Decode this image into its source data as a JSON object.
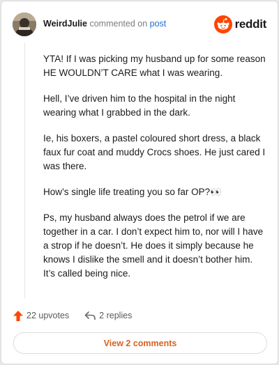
{
  "comment": {
    "username": "WeirdJulie",
    "action_text": "commented on",
    "post_link": "post",
    "paragraphs": [
      "YTA! If I was picking my husband up for some reason HE WOULDN’T CARE what I was wearing.",
      "Hell, I’ve driven him to the hospital in the night wearing what I grabbed in the dark.",
      "Ie, his boxers, a pastel coloured short dress, a black faux fur coat and muddy Crocs shoes. He just cared I was there.",
      "How’s single life treating you so far OP?👀",
      "Ps, my husband always does the petrol if we are together in a car. I don’t expect him to, nor will I have a strop if he doesn’t. He does it simply because he knows I dislike the smell and it doesn’t bother him. It’s called being nice."
    ]
  },
  "brand": {
    "name": "reddit",
    "icon": "reddit-snoo-icon",
    "color": "#ff4500"
  },
  "actions": {
    "upvotes": "22 upvotes",
    "replies": "2 replies",
    "upvote_icon": "upvote-arrow-icon",
    "reply_icon": "reply-arrow-icon",
    "upvote_color": "#ff4500"
  },
  "footer": {
    "view_comments": "View 2 comments",
    "accent": "#d9621f"
  }
}
